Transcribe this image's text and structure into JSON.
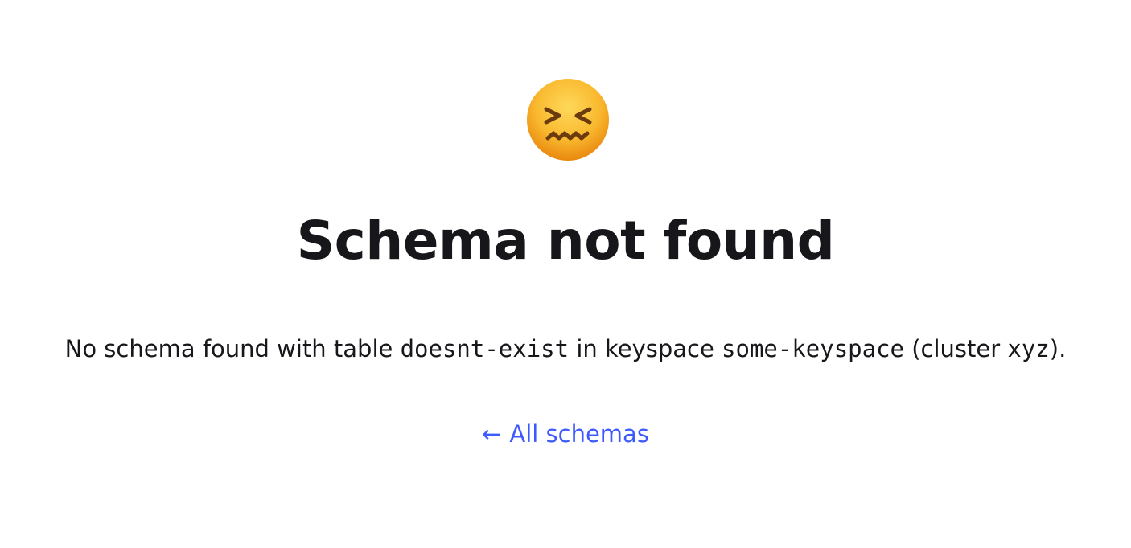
{
  "emoji": {
    "name": "confounded-face-icon",
    "face_color": "#f7b42c",
    "feature_color": "#6b3a0d"
  },
  "title": "Schema not found",
  "message": {
    "prefix": "No schema found with table",
    "table": "doesnt-exist",
    "middle": "in keyspace",
    "keyspace": "some-keyspace",
    "cluster_open": "(cluster",
    "cluster": "xyz",
    "cluster_close": ")."
  },
  "back_link": {
    "arrow": "←",
    "label": "All schemas",
    "color": "#3d5afe"
  }
}
